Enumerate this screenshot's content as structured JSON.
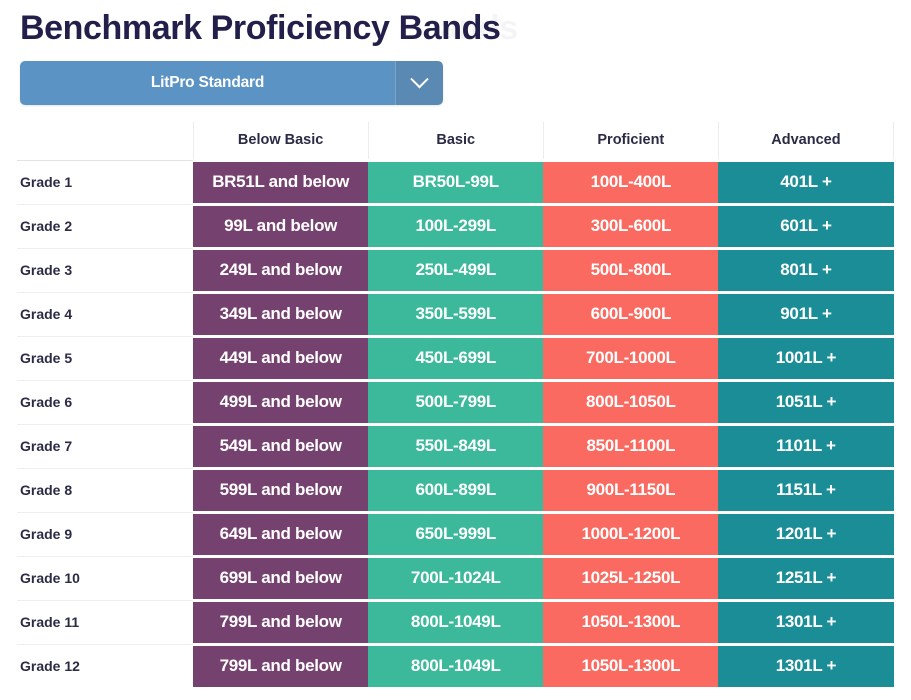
{
  "header": {
    "title": "Benchmark Proficiency Bands",
    "ghost_title": "ands"
  },
  "dropdown": {
    "selected": "LitPro Standard",
    "toggle_icon": "chevron-down-icon"
  },
  "colors": {
    "title": "#221f4b",
    "dropdown_bg": "#5b93c4",
    "dropdown_toggle_bg": "#5a89b4",
    "below_basic": "#75426f",
    "basic": "#3bb99a",
    "proficient": "#fa6a60",
    "advanced": "#1b8d96"
  },
  "table": {
    "columns": [
      "",
      "Below Basic",
      "Basic",
      "Proficient",
      "Advanced"
    ],
    "rows": [
      {
        "grade": "Grade 1",
        "below_basic": "BR51L and below",
        "basic": "BR50L-99L",
        "proficient": "100L-400L",
        "advanced": "401L +"
      },
      {
        "grade": "Grade 2",
        "below_basic": "99L and below",
        "basic": "100L-299L",
        "proficient": "300L-600L",
        "advanced": "601L +"
      },
      {
        "grade": "Grade 3",
        "below_basic": "249L and below",
        "basic": "250L-499L",
        "proficient": "500L-800L",
        "advanced": "801L +"
      },
      {
        "grade": "Grade 4",
        "below_basic": "349L and below",
        "basic": "350L-599L",
        "proficient": "600L-900L",
        "advanced": "901L +"
      },
      {
        "grade": "Grade 5",
        "below_basic": "449L and below",
        "basic": "450L-699L",
        "proficient": "700L-1000L",
        "advanced": "1001L +"
      },
      {
        "grade": "Grade 6",
        "below_basic": "499L and below",
        "basic": "500L-799L",
        "proficient": "800L-1050L",
        "advanced": "1051L +"
      },
      {
        "grade": "Grade 7",
        "below_basic": "549L and below",
        "basic": "550L-849L",
        "proficient": "850L-1100L",
        "advanced": "1101L +"
      },
      {
        "grade": "Grade 8",
        "below_basic": "599L and below",
        "basic": "600L-899L",
        "proficient": "900L-1150L",
        "advanced": "1151L +"
      },
      {
        "grade": "Grade 9",
        "below_basic": "649L and below",
        "basic": "650L-999L",
        "proficient": "1000L-1200L",
        "advanced": "1201L +"
      },
      {
        "grade": "Grade 10",
        "below_basic": "699L and below",
        "basic": "700L-1024L",
        "proficient": "1025L-1250L",
        "advanced": "1251L +"
      },
      {
        "grade": "Grade 11",
        "below_basic": "799L and below",
        "basic": "800L-1049L",
        "proficient": "1050L-1300L",
        "advanced": "1301L +"
      },
      {
        "grade": "Grade 12",
        "below_basic": "799L and below",
        "basic": "800L-1049L",
        "proficient": "1050L-1300L",
        "advanced": "1301L +"
      }
    ]
  }
}
